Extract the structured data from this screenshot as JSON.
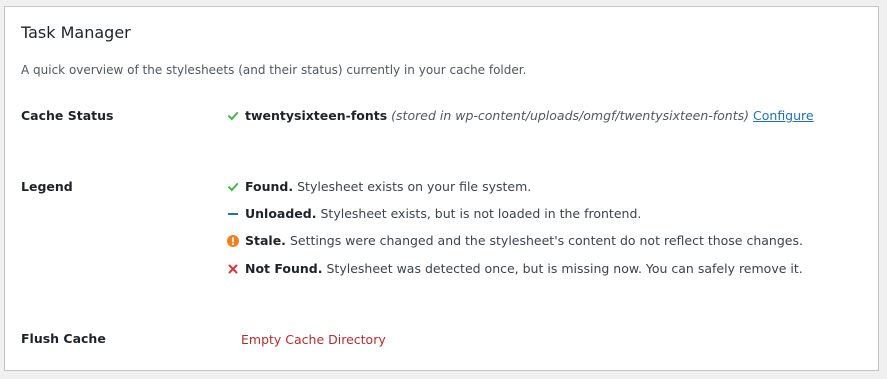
{
  "panel": {
    "title": "Task Manager",
    "description": "A quick overview of the stylesheets (and their status) currently in your cache folder."
  },
  "cache_status": {
    "label": "Cache Status",
    "items": [
      {
        "status_icon": "check-icon",
        "name": "twentysixteen-fonts",
        "location": "(stored in wp-content/uploads/omgf/twentysixteen-fonts)",
        "action": "Configure"
      }
    ]
  },
  "legend": {
    "label": "Legend",
    "entries": [
      {
        "icon": "check-icon",
        "color": "#46b450",
        "term": "Found.",
        "text": "Stylesheet exists on your file system."
      },
      {
        "icon": "dash-icon",
        "color": "#2271b1",
        "term": "Unloaded.",
        "text": "Stylesheet exists, but is not loaded in the frontend."
      },
      {
        "icon": "warning-icon",
        "color": "#f0821e",
        "term": "Stale.",
        "text": "Settings were changed and the stylesheet's content do not reflect those changes."
      },
      {
        "icon": "cross-icon",
        "color": "#d63638",
        "term": "Not Found.",
        "text": "Stylesheet was detected once, but is missing now. You can safely remove it."
      }
    ]
  },
  "flush_cache": {
    "label": "Flush Cache",
    "button": "Empty Cache Directory"
  }
}
